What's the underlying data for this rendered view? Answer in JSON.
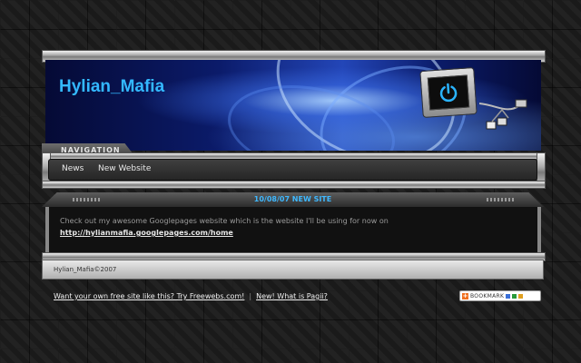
{
  "site": {
    "title": "Hylian_Mafia"
  },
  "navigation": {
    "heading": "NAVIGATION",
    "items": [
      {
        "label": "News"
      },
      {
        "label": "New Website"
      }
    ]
  },
  "post": {
    "title": "10/08/07 NEW SITE",
    "body": "Check out my awesome Googlepages website which is the website I'll be using for now on",
    "link": "http://hylianmafia.googlepages.com/home"
  },
  "footer": {
    "copyright": "Hylian_Mafia©2007"
  },
  "bottom_links": {
    "freewebs": "Want your own free site like this? Try Freewebs.com!",
    "separator": "|",
    "pagii": "New! What is Pagii?"
  },
  "bookmark": {
    "label": "BOOKMARK",
    "plus": "+"
  },
  "colors": {
    "accent": "#33b8ff",
    "banner": "#0b1b6a",
    "background": "#1c1c1c"
  },
  "icons": {
    "monitor": "power-button-monitor-icon",
    "cable": "cable-connector-icon"
  }
}
